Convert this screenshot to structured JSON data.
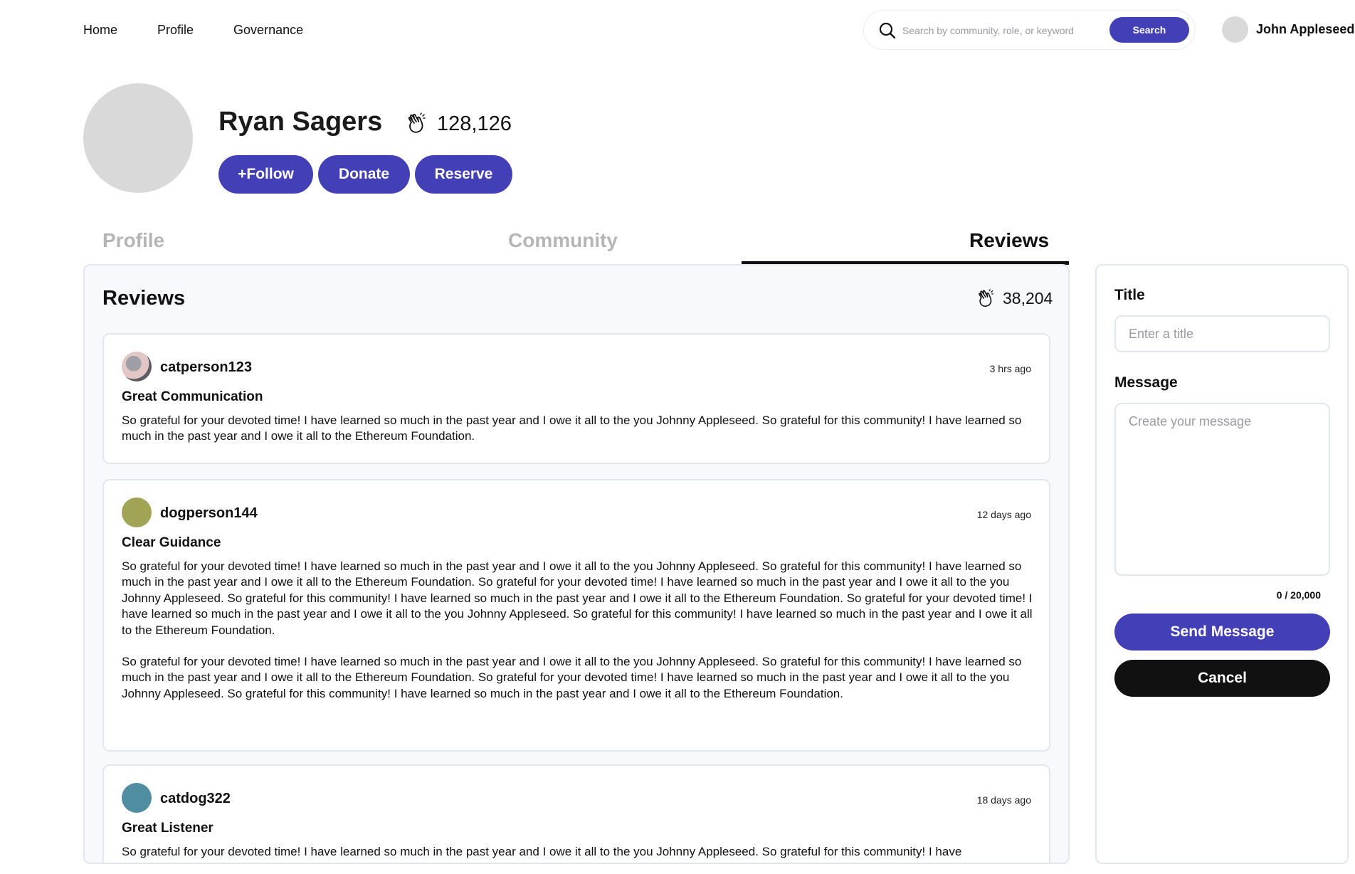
{
  "nav": {
    "items": [
      {
        "label": "Home"
      },
      {
        "label": "Profile"
      },
      {
        "label": "Governance"
      }
    ]
  },
  "search": {
    "placeholder": "Search by community, role, or keyword",
    "button_label": "Search",
    "icon": "search-icon"
  },
  "user": {
    "name": "John Appleseed"
  },
  "profile": {
    "name": "Ryan Sagers",
    "clap_count": "128,126",
    "icon": "clap-icon",
    "actions": {
      "follow": "+Follow",
      "donate": "Donate",
      "reserve": "Reserve"
    }
  },
  "tabs": [
    {
      "label": "Profile",
      "active": false
    },
    {
      "label": "Community",
      "active": false
    },
    {
      "label": "Reviews",
      "active": true
    }
  ],
  "reviews": {
    "title": "Reviews",
    "clap_count": "38,204",
    "items": [
      {
        "username": "catperson123",
        "time": "3 hrs ago",
        "title": "Great Communication",
        "paragraphs": [
          "So grateful for your devoted time! I have learned so much in the past year and I owe it all to the you Johnny Appleseed. So grateful for this community! I have learned so much in the past year and I owe it all to the Ethereum Foundation."
        ]
      },
      {
        "username": "dogperson144",
        "time": "12 days ago",
        "title": "Clear Guidance",
        "paragraphs": [
          "So grateful for your devoted time! I have learned so much in the past year and I owe it all to the you Johnny Appleseed. So grateful for this community! I have learned so much in the past year and I owe it all to the Ethereum Foundation. So grateful for your devoted time! I have learned so much in the past year and I owe it all to the you Johnny Appleseed. So grateful for this community! I have learned so much in the past year and I owe it all to the Ethereum Foundation. So grateful for your devoted time! I have learned so much in the past year and I owe it all to the you Johnny Appleseed. So grateful for this community! I have learned so much in the past year and I owe it all to the Ethereum Foundation.",
          "So grateful for your devoted time! I have learned so much in the past year and I owe it all to the you Johnny Appleseed. So grateful for this community! I have learned so much in the past year and I owe it all to the Ethereum Foundation. So grateful for your devoted time! I have learned so much in the past year and I owe it all to the you Johnny Appleseed. So grateful for this community! I have learned so much in the past year and I owe it all to the Ethereum Foundation."
        ]
      },
      {
        "username": "catdog322",
        "time": "18 days ago",
        "title": "Great Listener",
        "paragraphs": [
          "So grateful for your devoted time! I have learned so much in the past year and I owe it all to the you Johnny Appleseed. So grateful for this community! I have"
        ]
      }
    ]
  },
  "message_form": {
    "title_label": "Title",
    "title_placeholder": "Enter a title",
    "message_label": "Message",
    "message_placeholder": "Create your message",
    "char_count": "0 / 20,000",
    "send_label": "Send Message",
    "cancel_label": "Cancel"
  },
  "colors": {
    "accent": "#4340b7",
    "dark": "#111111",
    "border": "#e3e6f0",
    "avatar_placeholder": "#d9d9d9",
    "avatar_dogperson144": "#a1a355",
    "avatar_catdog322": "#4e8ea0"
  }
}
